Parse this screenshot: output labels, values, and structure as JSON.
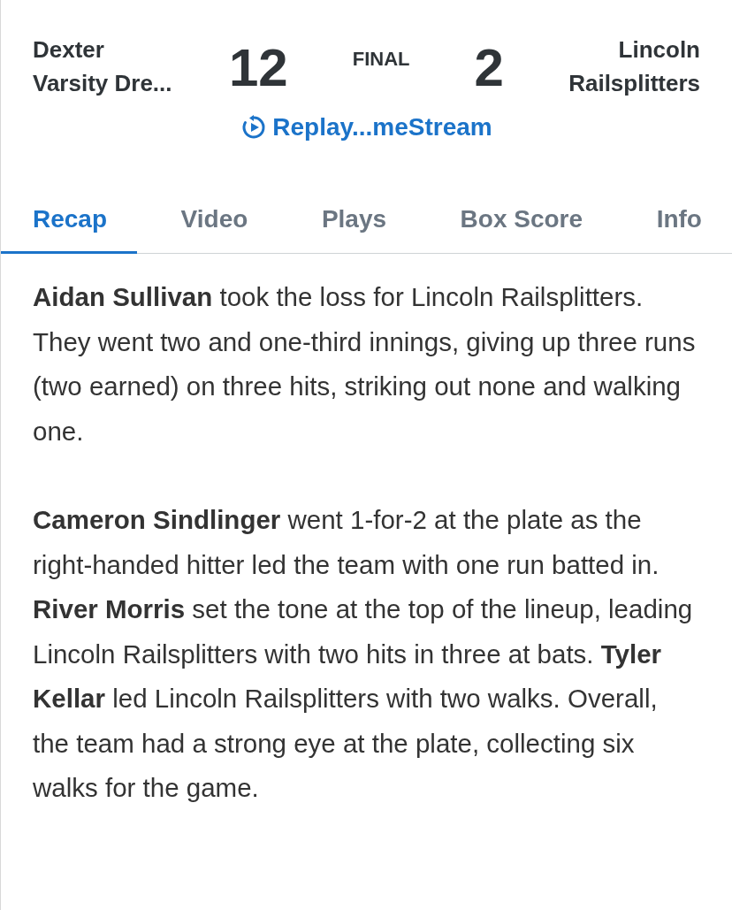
{
  "header": {
    "home_team": "Dexter\nVarsity Dre...",
    "home_score": "12",
    "status": "FINAL",
    "away_score": "2",
    "away_team": "Lincoln\nRailsplitters",
    "replay_link": "Replay...meStream"
  },
  "tabs": [
    {
      "label": "Recap",
      "selected": true
    },
    {
      "label": "Video",
      "selected": false
    },
    {
      "label": "Plays",
      "selected": false
    },
    {
      "label": "Box Score",
      "selected": false
    },
    {
      "label": "Info",
      "selected": false
    }
  ],
  "paragraphs": [
    "**Aidan Sullivan** took the loss for Lincoln Railsplitters. They went two and one-third innings, giving up three runs (two earned) on three hits, striking out none and walking one.",
    "**Cameron Sindlinger** went 1-for-2 at the plate as the right-handed hitter led the team with one run batted in. **River Morris** set the tone at the top of the lineup, leading Lincoln Railsplitters with two hits in three at bats. **Tyler Kellar** led Lincoln Railsplitters with two walks. Overall, the team had a strong eye at the plate, collecting six walks for the game."
  ]
}
